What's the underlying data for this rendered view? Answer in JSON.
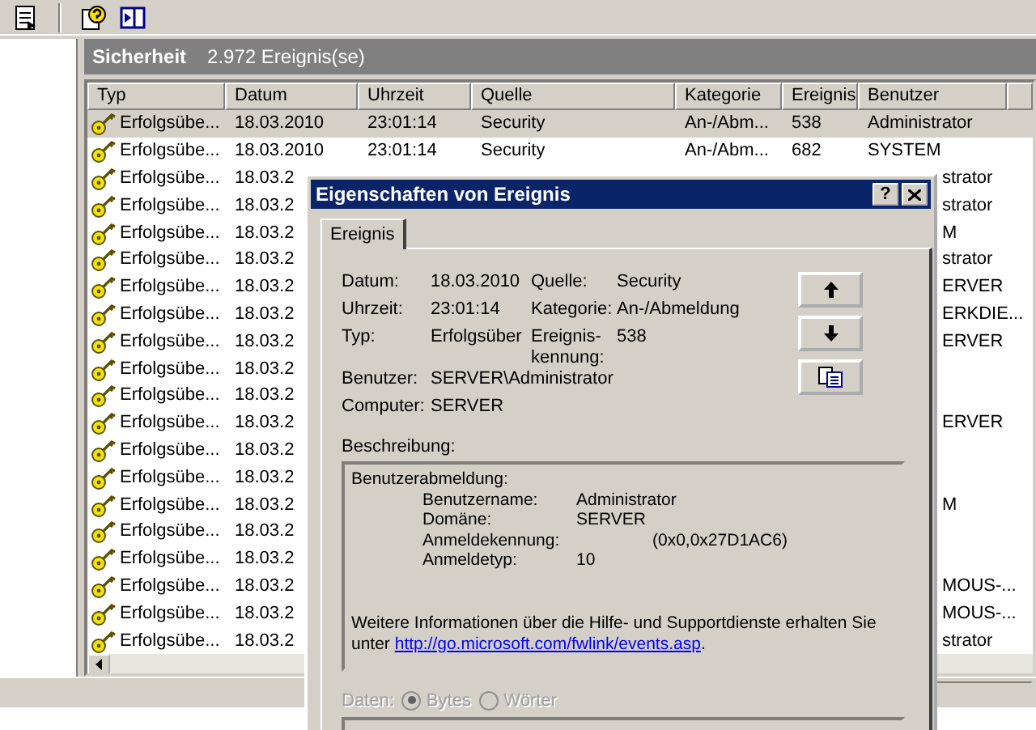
{
  "event_list": {
    "title": "Sicherheit",
    "count": "2.972 Ereignis(se)",
    "columns": [
      "Typ",
      "Datum",
      "Uhrzeit",
      "Quelle",
      "Kategorie",
      "Ereignis",
      "Benutzer"
    ],
    "rows": [
      {
        "kind": "full",
        "selected": true,
        "cells": [
          "Erfolgsübe...",
          "18.03.2010",
          "23:01:14",
          "Security",
          "An-/Abm...",
          "538",
          "Administrator"
        ]
      },
      {
        "kind": "full",
        "selected": false,
        "cells": [
          "Erfolgsübe...",
          "18.03.2010",
          "23:01:14",
          "Security",
          "An-/Abm...",
          "682",
          "SYSTEM"
        ]
      },
      {
        "kind": "covered",
        "selected": false,
        "cells": [
          "Erfolgsübe...",
          "18.03.2"
        ],
        "user_part": "strator"
      },
      {
        "kind": "covered",
        "selected": false,
        "cells": [
          "Erfolgsübe...",
          "18.03.2"
        ],
        "user_part": "strator"
      },
      {
        "kind": "covered",
        "selected": false,
        "cells": [
          "Erfolgsübe...",
          "18.03.2"
        ],
        "user_part": "M"
      },
      {
        "kind": "covered",
        "selected": false,
        "cells": [
          "Erfolgsübe...",
          "18.03.2"
        ],
        "user_part": "strator"
      },
      {
        "kind": "covered",
        "selected": false,
        "cells": [
          "Erfolgsübe...",
          "18.03.2"
        ],
        "user_part": "ERVER"
      },
      {
        "kind": "covered",
        "selected": false,
        "cells": [
          "Erfolgsübe...",
          "18.03.2"
        ],
        "user_part": "ERKDIE..."
      },
      {
        "kind": "covered",
        "selected": false,
        "cells": [
          "Erfolgsübe...",
          "18.03.2"
        ],
        "user_part": "ERVER"
      },
      {
        "kind": "covered",
        "selected": false,
        "cells": [
          "Erfolgsübe...",
          "18.03.2"
        ]
      },
      {
        "kind": "covered",
        "selected": false,
        "cells": [
          "Erfolgsübe...",
          "18.03.2"
        ]
      },
      {
        "kind": "covered",
        "selected": false,
        "cells": [
          "Erfolgsübe...",
          "18.03.2"
        ],
        "user_part": "ERVER"
      },
      {
        "kind": "covered",
        "selected": false,
        "cells": [
          "Erfolgsübe...",
          "18.03.2"
        ]
      },
      {
        "kind": "covered",
        "selected": false,
        "cells": [
          "Erfolgsübe...",
          "18.03.2"
        ]
      },
      {
        "kind": "covered",
        "selected": false,
        "cells": [
          "Erfolgsübe...",
          "18.03.2"
        ],
        "user_part": "M"
      },
      {
        "kind": "covered",
        "selected": false,
        "cells": [
          "Erfolgsübe...",
          "18.03.2"
        ]
      },
      {
        "kind": "covered",
        "selected": false,
        "cells": [
          "Erfolgsübe...",
          "18.03.2"
        ]
      },
      {
        "kind": "covered",
        "selected": false,
        "cells": [
          "Erfolgsübe...",
          "18.03.2"
        ],
        "user_part": "MOUS-..."
      },
      {
        "kind": "covered",
        "selected": false,
        "cells": [
          "Erfolgsübe...",
          "18.03.2"
        ],
        "user_part": "MOUS-..."
      },
      {
        "kind": "covered",
        "selected": false,
        "cells": [
          "Erfolgsübe...",
          "18.03.2"
        ],
        "user_part": "strator"
      }
    ]
  },
  "dialog": {
    "title": "Eigenschaften von Ereignis",
    "help_button": "?",
    "tabs": [
      {
        "label": "Ereignis",
        "selected": true
      }
    ],
    "left_fields": [
      {
        "label": "Datum:",
        "value": "18.03.2010"
      },
      {
        "label": "Uhrzeit:",
        "value": "23:01:14"
      },
      {
        "label": "Typ:",
        "value": "Erfolgsüber"
      }
    ],
    "right_fields": [
      {
        "label": "Quelle:",
        "value": "Security"
      },
      {
        "label": "Kategorie:",
        "value": "An-/Abmeldung"
      },
      {
        "label": "Ereignis-\nkennung:",
        "value": "538"
      }
    ],
    "wide_fields": [
      {
        "label": "Benutzer:",
        "value": "SERVER\\Administrator"
      },
      {
        "label": "Computer:",
        "value": "SERVER"
      }
    ],
    "description": {
      "label": "Beschreibung:",
      "heading": "Benutzerabmeldung:",
      "entries": [
        {
          "kind": "plain",
          "label": "Benutzername:",
          "value": "Administrator"
        },
        {
          "kind": "plain",
          "label": "Domäne:",
          "value": "SERVER"
        },
        {
          "kind": "tabbed",
          "label": "Anmeldekennung:",
          "value": "(0x0,0x27D1AC6)"
        },
        {
          "kind": "plain",
          "label": "Anmeldetyp:",
          "value": "10"
        }
      ],
      "info": "Weitere Informationen über die Hilfe- und Supportdienste erhalten Sie unter ",
      "link": "http://go.microsoft.com/fwlink/events.asp",
      "info_end": "."
    },
    "data_format": {
      "label": "Daten:",
      "disabled": true,
      "options": [
        {
          "label": "Bytes",
          "selected": true
        },
        {
          "label": "Wörter",
          "selected": false
        }
      ]
    }
  }
}
